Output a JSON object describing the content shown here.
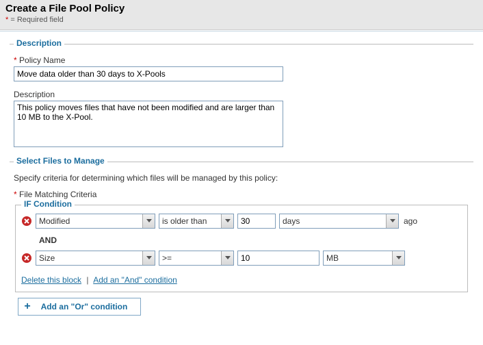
{
  "header": {
    "title": "Create a File Pool Policy",
    "required_note_prefix": "*",
    "required_note": " = Required field"
  },
  "description_section": {
    "legend": "Description",
    "policy_name_label": "Policy Name",
    "policy_name_value": "Move data older than 30 days to X-Pools",
    "description_label": "Description",
    "description_value": "This policy moves files that have not been modified and are larger than 10 MB to the X-Pool."
  },
  "select_section": {
    "legend": "Select Files to Manage",
    "note": "Specify criteria for determining which files will be managed by this policy:",
    "criteria_label": "File Matching Criteria",
    "if_legend": "IF Condition",
    "row1": {
      "attribute": "Modified",
      "operator": "is older than",
      "value": "30",
      "unit": "days",
      "suffix": "ago"
    },
    "and_label": "AND",
    "row2": {
      "attribute": "Size",
      "operator": ">=",
      "value": "10",
      "unit": "MB"
    },
    "links": {
      "delete_block": "Delete this block",
      "add_and": "Add an \"And\" condition"
    },
    "or_button": "Add an \"Or\" condition"
  }
}
